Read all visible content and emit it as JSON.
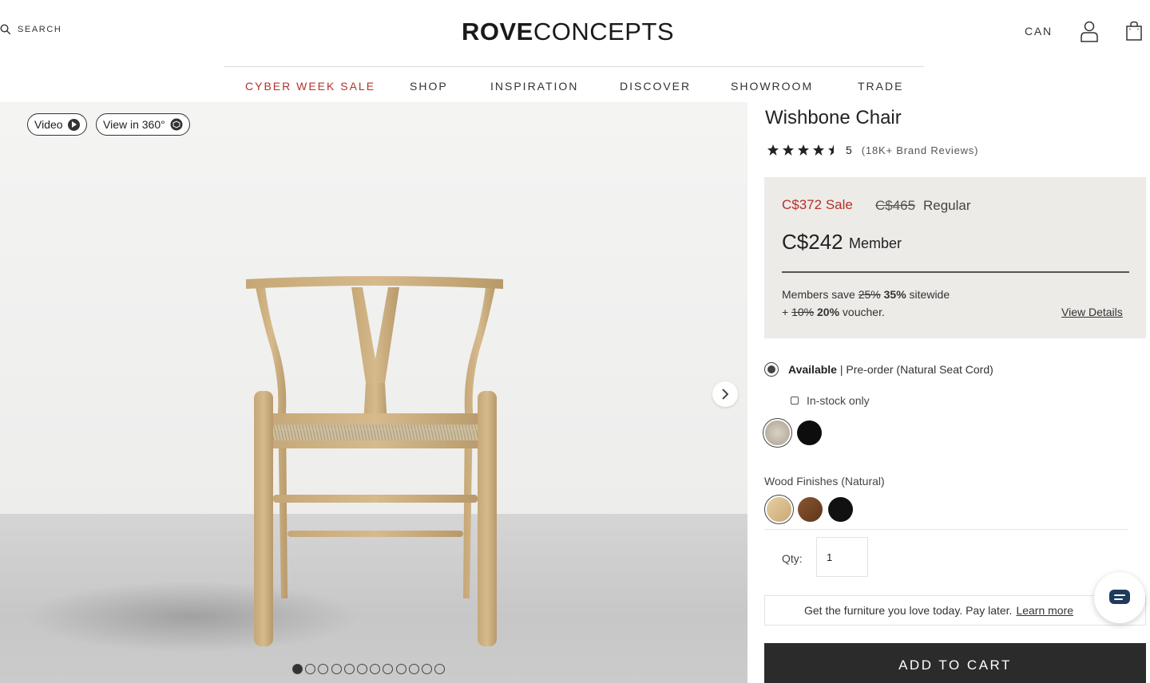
{
  "header": {
    "search_label": "SEARCH",
    "logo_bold": "ROVE",
    "logo_light": "CONCEPTS",
    "country": "CAN"
  },
  "nav": {
    "items": [
      "CYBER WEEK SALE",
      "SHOP",
      "INSPIRATION",
      "DISCOVER",
      "SHOWROOM",
      "TRADE"
    ]
  },
  "gallery": {
    "video_label": "Video",
    "view360_label": "View in 360°",
    "image_count": 12,
    "active_index": 0
  },
  "product": {
    "title": "Wishbone Chair",
    "rating_value": "5",
    "rating_stars": 4.5,
    "rating_text": "(18K+ Brand Reviews)",
    "sale_price": "C$372 Sale",
    "regular_price": "C$465",
    "regular_label": "Regular",
    "member_price": "C$242",
    "member_label": "Member",
    "members_save_prefix": "Members save",
    "members_save_old": "25%",
    "members_save_new": "35%",
    "members_save_suffix": "sitewide",
    "voucher_prefix": "+",
    "voucher_old": "10%",
    "voucher_new": "20%",
    "voucher_suffix": "voucher.",
    "view_details": "View Details",
    "availability_strong": "Available",
    "availability_rest": "| Pre-order (Natural Seat Cord)",
    "instock_label": "In-stock only",
    "seat_swatches": [
      "natural-cord",
      "black"
    ],
    "wood_label": "Wood Finishes (Natural)",
    "wood_swatches": [
      "natural",
      "walnut",
      "black"
    ],
    "qty_label": "Qty:",
    "qty_value": "1",
    "paylater_text": "Get the furniture you love today. Pay later.",
    "paylater_link": "Learn more",
    "add_to_cart": "ADD TO CART"
  },
  "colors": {
    "sale_red": "#b3322b",
    "price_box_bg": "#edebe8",
    "cart_button": "#2b2b2b",
    "chat_icon": "#1f3b5c"
  }
}
